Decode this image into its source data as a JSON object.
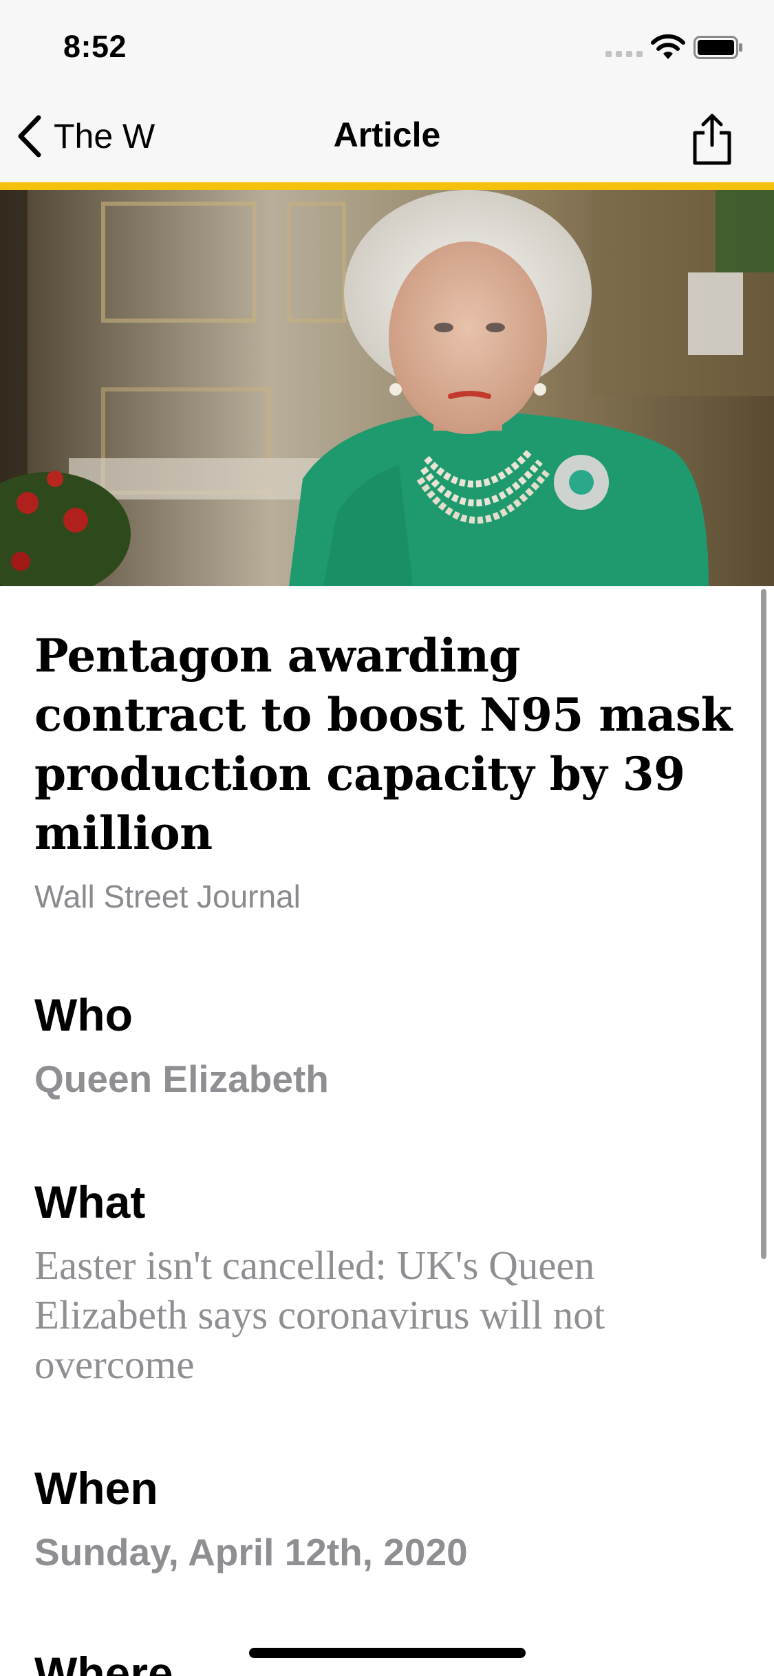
{
  "status_bar": {
    "time": "8:52",
    "signal_icon": "signal-bars-icon",
    "wifi_icon": "wifi-icon",
    "battery_icon": "battery-icon"
  },
  "nav": {
    "back_label": "The W",
    "back_icon": "chevron-left-icon",
    "title": "Article",
    "share_icon": "share-icon",
    "accent_color": "#f4c20d"
  },
  "article": {
    "headline": "Pentagon awarding contract to boost N95 mask production capacity by 39 million",
    "source": "Wall Street Journal",
    "sections": {
      "who": {
        "label": "Who",
        "value": "Queen Elizabeth"
      },
      "what": {
        "label": "What",
        "value": "Easter isn't cancelled: UK's Queen Elizabeth says coronavirus will not overcome"
      },
      "when": {
        "label": "When",
        "value": "Sunday, April 12th, 2020"
      },
      "where": {
        "label": "Where"
      }
    }
  }
}
